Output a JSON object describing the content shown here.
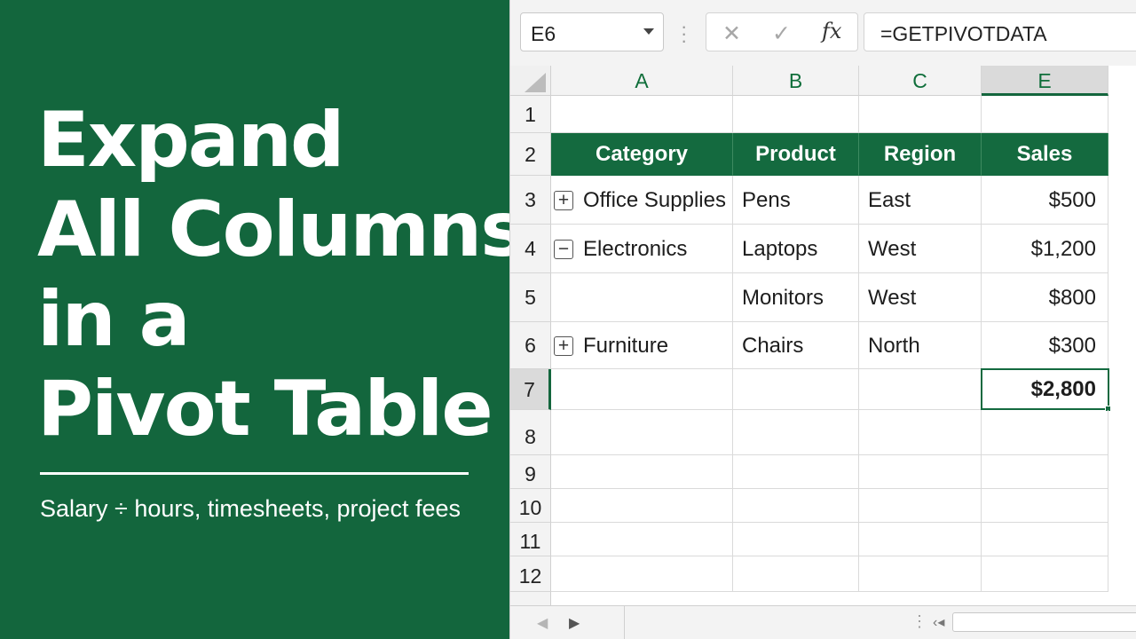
{
  "promo": {
    "title_lines": [
      "Expand",
      "All Columns",
      "in a",
      "Pivot Table"
    ],
    "subtitle": "Salary ÷ hours, timesheets, project fees",
    "background": "#13663d"
  },
  "formula_bar": {
    "name_box": "E6",
    "cancel_icon": "✕",
    "enter_icon": "✓",
    "fx_label": "fx",
    "formula": "=GETPIVOTDATA"
  },
  "columns": [
    "A",
    "B",
    "C",
    "E"
  ],
  "selected_column": "E",
  "rows": [
    "1",
    "2",
    "3",
    "4",
    "5",
    "6",
    "7",
    "8",
    "9",
    "10",
    "11",
    "12"
  ],
  "selected_row": "7",
  "pivot": {
    "headers": [
      "Category",
      "Product",
      "Region",
      "Sales"
    ],
    "rows": [
      {
        "toggle": "+",
        "category": "Office Supplies",
        "product": "Pens",
        "region": "East",
        "sales": "$500"
      },
      {
        "toggle": "−",
        "category": "Electronics",
        "product": "Laptops",
        "region": "West",
        "sales": "$1,200"
      },
      {
        "toggle": "",
        "category": "",
        "product": "Monitors",
        "region": "West",
        "sales": "$800"
      },
      {
        "toggle": "+",
        "category": "Furniture",
        "product": "Chairs",
        "region": "North",
        "sales": "$300"
      }
    ],
    "total": "$2,800"
  },
  "colors": {
    "accent": "#146a3f",
    "header_text": "#ffffff",
    "column_letters": "#0f6e3a"
  }
}
